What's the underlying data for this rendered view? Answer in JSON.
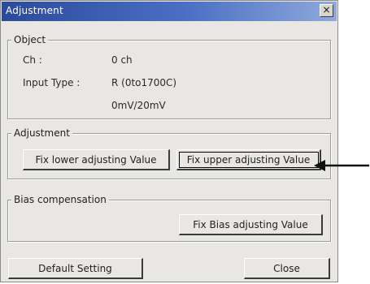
{
  "window": {
    "title": "Adjustment",
    "close_glyph": "×"
  },
  "object_group": {
    "label": "Object",
    "ch_label": "Ch :",
    "ch_value": "0 ch",
    "input_type_label": "Input Type :",
    "input_type_value": "R (0to1700C)",
    "range_value": "0mV/20mV"
  },
  "adjustment_group": {
    "label": "Adjustment",
    "fix_lower_button": "Fix lower adjusting Value",
    "fix_upper_button": "Fix upper adjusting Value"
  },
  "bias_group": {
    "label": "Bias compensation",
    "fix_bias_button": "Fix Bias adjusting Value"
  },
  "footer": {
    "default_button": "Default Setting",
    "close_button": "Close"
  },
  "icons": {
    "close": "close-icon",
    "pointer": "arrow-pointer"
  },
  "colors": {
    "titlebar": "#2b4a99",
    "face": "#e9e7e3"
  }
}
